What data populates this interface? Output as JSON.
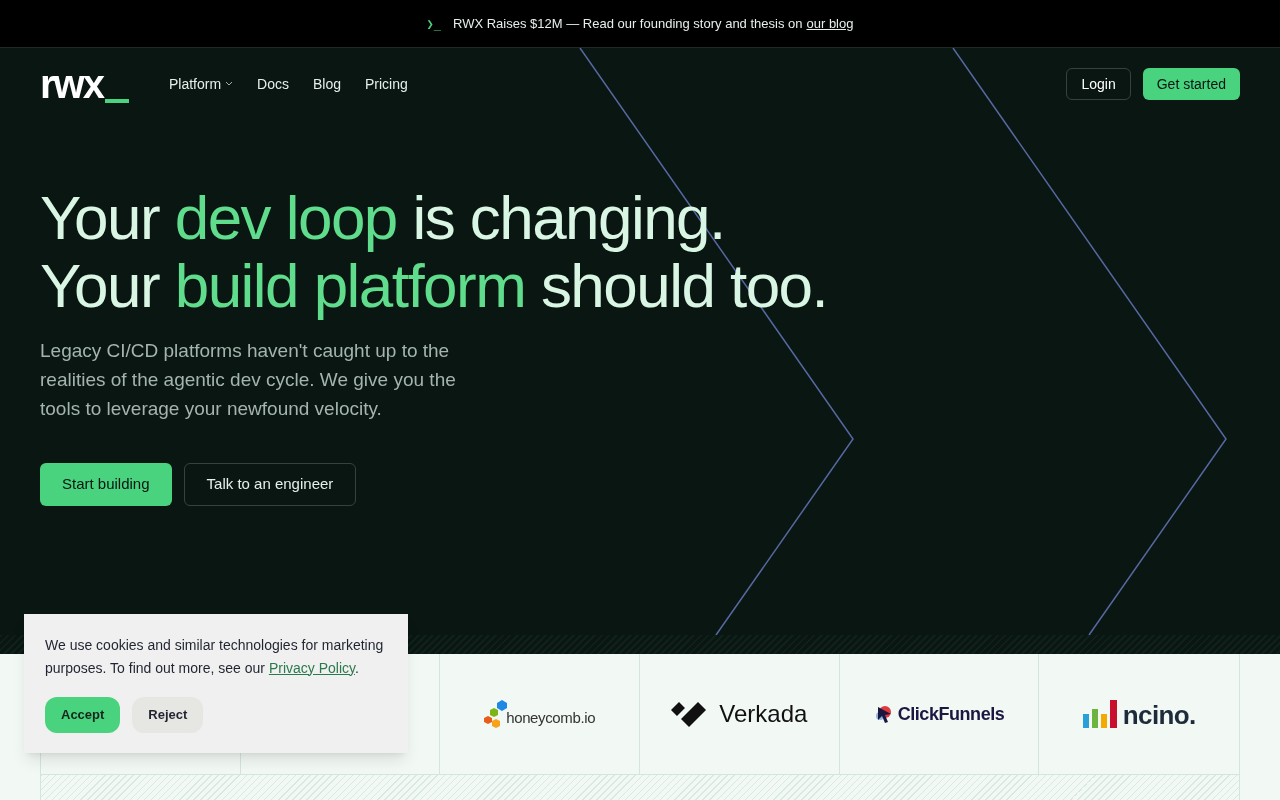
{
  "announcement": {
    "prompt": "❯_",
    "text": "RWX Raises $12M — Read our founding story and thesis on",
    "link": "our blog"
  },
  "nav": {
    "logo": "rwx",
    "items": [
      {
        "label": "Platform",
        "dropdown": true
      },
      {
        "label": "Docs",
        "dropdown": false
      },
      {
        "label": "Blog",
        "dropdown": false
      },
      {
        "label": "Pricing",
        "dropdown": false
      }
    ],
    "login": "Login",
    "cta": "Get started"
  },
  "hero": {
    "lines": [
      [
        {
          "text": "Your ",
          "accent": false
        },
        {
          "text": "dev loop",
          "accent": true
        },
        {
          "text": " is changing.",
          "accent": false
        }
      ],
      [
        {
          "text": "Your ",
          "accent": false
        },
        {
          "text": "build platform",
          "accent": true
        },
        {
          "text": " should too.",
          "accent": false
        }
      ]
    ],
    "subtitle": "Legacy CI/CD platforms haven't caught up to the realities of the agentic dev cycle. We give you the tools to leverage your newfound velocity.",
    "buttons": [
      {
        "label": "Start building",
        "kind": "primary"
      },
      {
        "label": "Talk to an engineer",
        "kind": "outline"
      }
    ]
  },
  "logos": [
    {
      "kind": "empty"
    },
    {
      "kind": "empty"
    },
    {
      "kind": "honeycomb",
      "name": "honeycomb.io"
    },
    {
      "kind": "verkada",
      "name": "Verkada"
    },
    {
      "kind": "clickfunnels",
      "name": "ClickFunnels"
    },
    {
      "kind": "ncino",
      "name": "ncino."
    }
  ],
  "cookie": {
    "text": "We use cookies and similar technologies for marketing purposes. To find out more, see our",
    "link": "Privacy Policy",
    "end": ".",
    "accept": "Accept",
    "reject": "Reject"
  }
}
